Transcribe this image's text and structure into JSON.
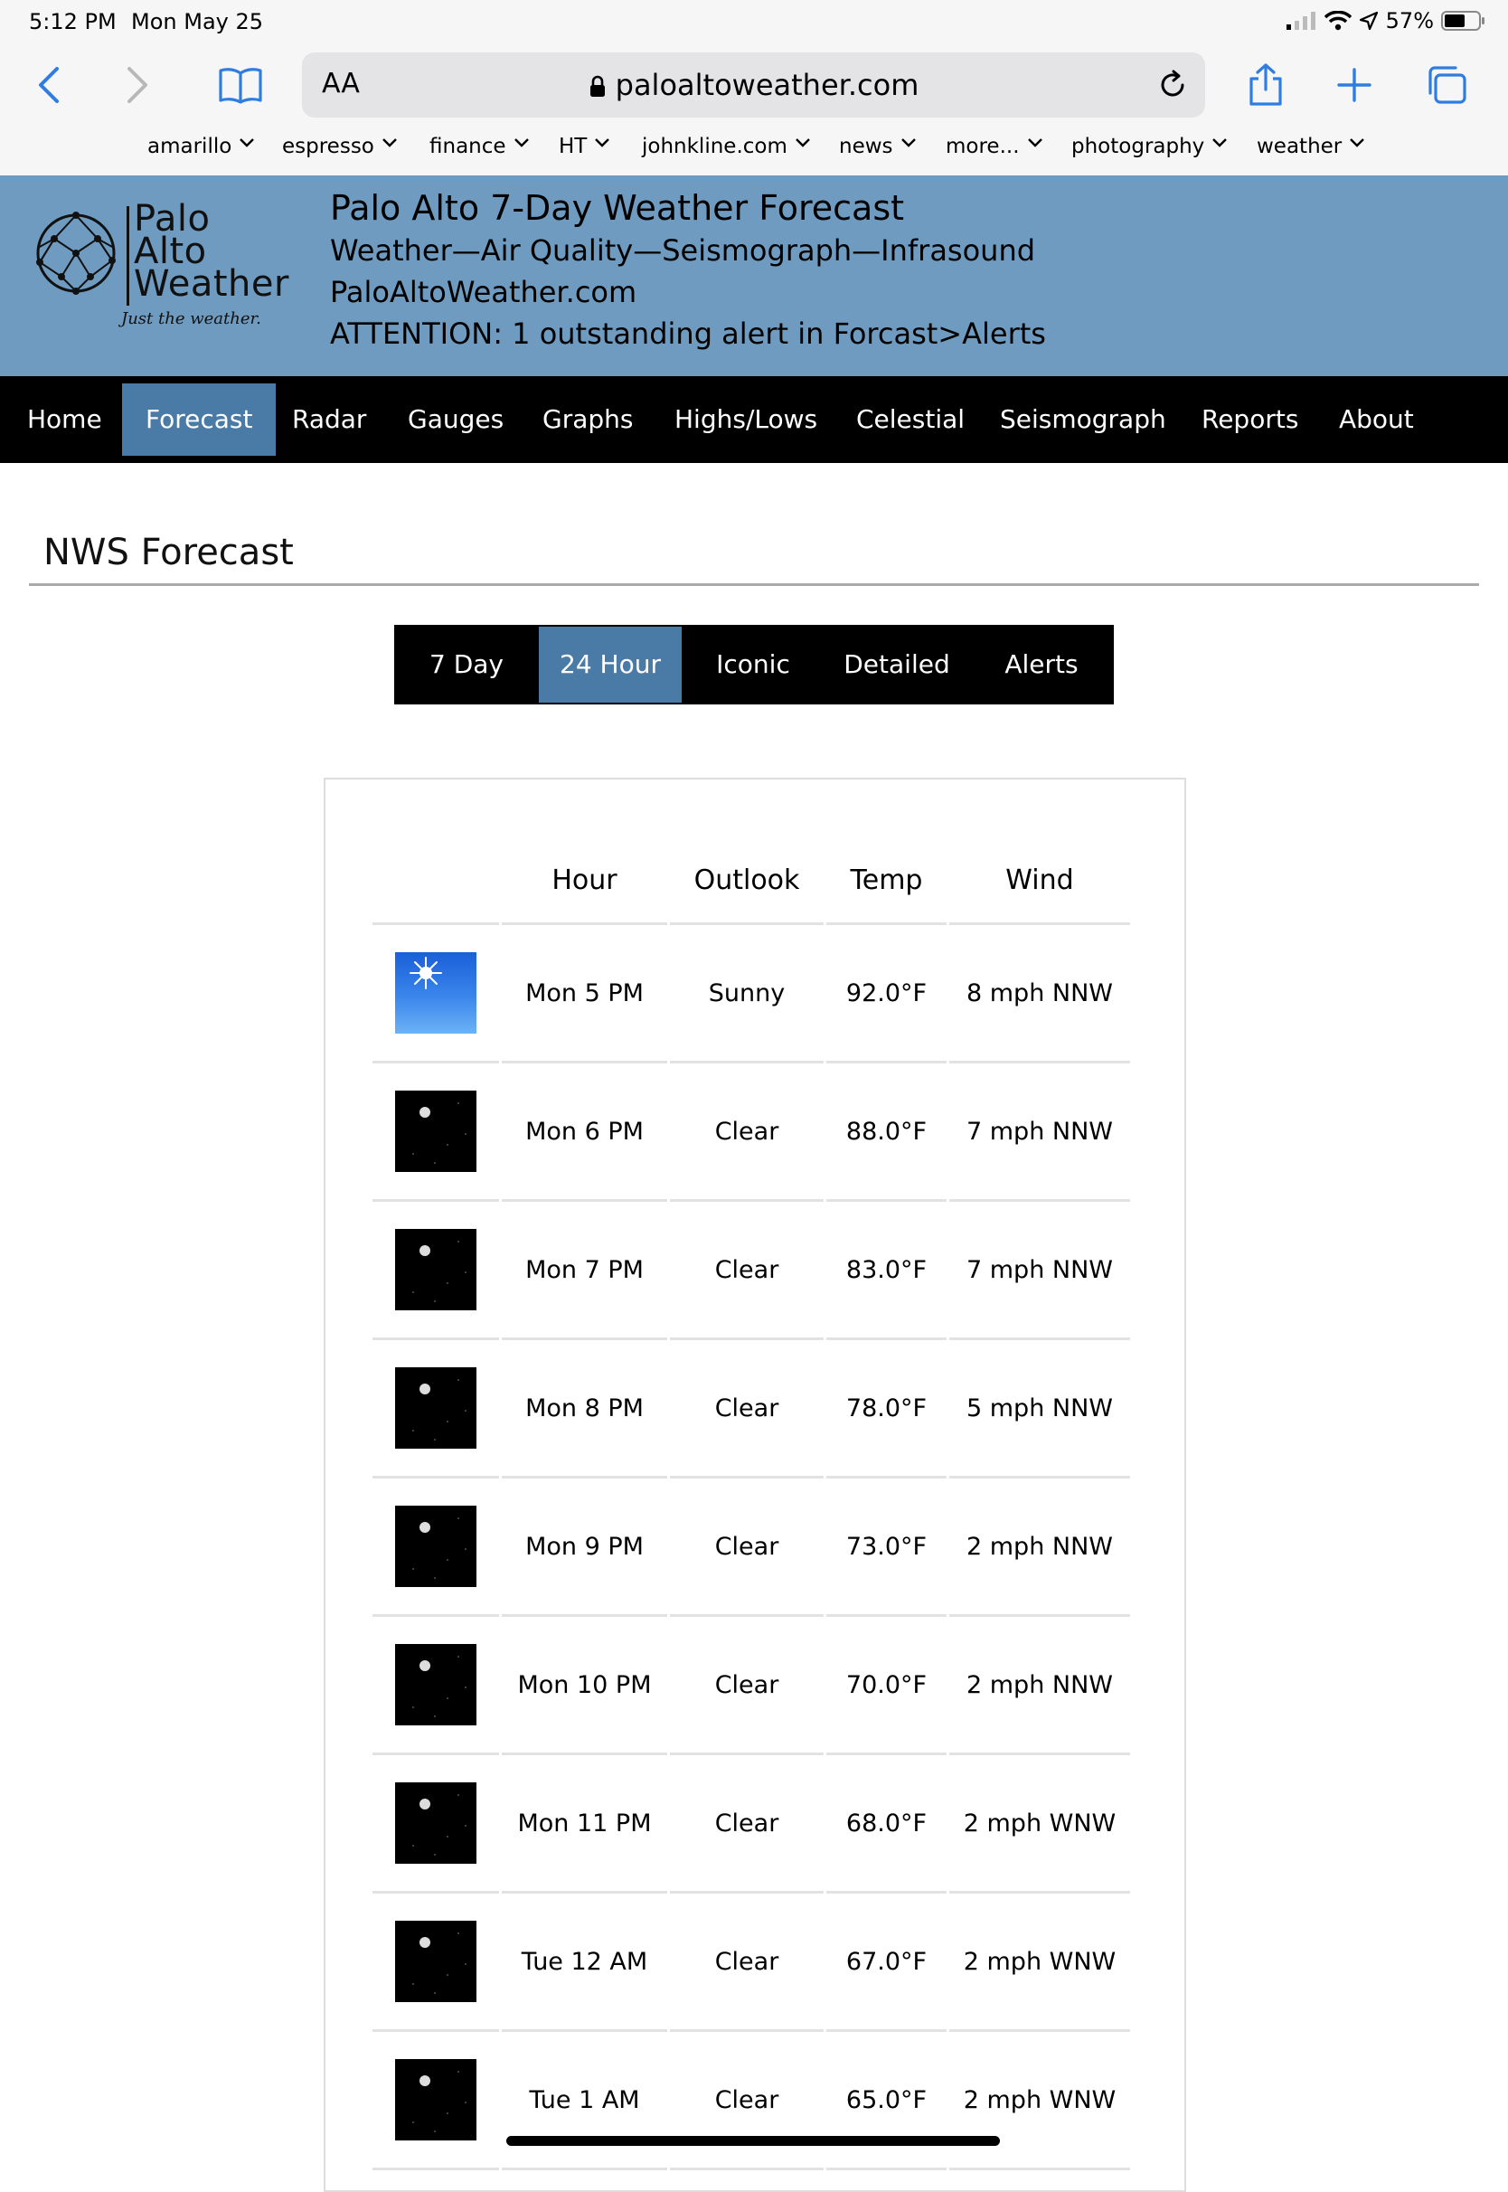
{
  "status_bar": {
    "time": "5:12 PM",
    "date": "Mon May 25",
    "battery": "57%"
  },
  "browser": {
    "aa_label": "AA",
    "url": "paloaltoweather.com",
    "favorites": [
      "amarillo",
      "espresso",
      "finance",
      "HT",
      "johnkline.com",
      "news",
      "more...",
      "photography",
      "weather"
    ]
  },
  "site_header": {
    "logo_lines": [
      "Palo",
      "Alto",
      "Weather"
    ],
    "logo_tagline": "Just the weather.",
    "title": "Palo Alto 7-Day Weather Forecast",
    "subtitle": "Weather—Air Quality—Seismograph—Infrasound",
    "site": "PaloAltoWeather.com",
    "alert": "ATTENTION: 1 outstanding alert in Forcast>Alerts"
  },
  "nav": {
    "items": [
      "Home",
      "Forecast",
      "Radar",
      "Gauges",
      "Graphs",
      "Highs/Lows",
      "Celestial",
      "Seismograph",
      "Reports",
      "About"
    ],
    "active": "Forecast"
  },
  "section_title": "NWS Forecast",
  "tabs": {
    "items": [
      "7 Day",
      "24 Hour",
      "Iconic",
      "Detailed",
      "Alerts"
    ],
    "active": "24 Hour"
  },
  "forecast_table": {
    "headers": [
      "",
      "Hour",
      "Outlook",
      "Temp",
      "Wind"
    ],
    "rows": [
      {
        "icon": "sunny-icon",
        "hour": "Mon 5 PM",
        "outlook": "Sunny",
        "temp": "92.0°F",
        "wind": "8 mph NNW"
      },
      {
        "icon": "clear-night-icon",
        "hour": "Mon 6 PM",
        "outlook": "Clear",
        "temp": "88.0°F",
        "wind": "7 mph NNW"
      },
      {
        "icon": "clear-night-icon",
        "hour": "Mon 7 PM",
        "outlook": "Clear",
        "temp": "83.0°F",
        "wind": "7 mph NNW"
      },
      {
        "icon": "clear-night-icon",
        "hour": "Mon 8 PM",
        "outlook": "Clear",
        "temp": "78.0°F",
        "wind": "5 mph NNW"
      },
      {
        "icon": "clear-night-icon",
        "hour": "Mon 9 PM",
        "outlook": "Clear",
        "temp": "73.0°F",
        "wind": "2 mph NNW"
      },
      {
        "icon": "clear-night-icon",
        "hour": "Mon 10 PM",
        "outlook": "Clear",
        "temp": "70.0°F",
        "wind": "2 mph NNW"
      },
      {
        "icon": "clear-night-icon",
        "hour": "Mon 11 PM",
        "outlook": "Clear",
        "temp": "68.0°F",
        "wind": "2 mph WNW"
      },
      {
        "icon": "clear-night-icon",
        "hour": "Tue 12 AM",
        "outlook": "Clear",
        "temp": "67.0°F",
        "wind": "2 mph WNW"
      },
      {
        "icon": "clear-night-icon",
        "hour": "Tue 1 AM",
        "outlook": "Clear",
        "temp": "65.0°F",
        "wind": "2 mph WNW"
      }
    ]
  },
  "colors": {
    "header_bg": "#6e9bbf",
    "nav_bg": "#000000",
    "active_bg": "#4a7ba6",
    "link_blue": "#2f7de1"
  }
}
